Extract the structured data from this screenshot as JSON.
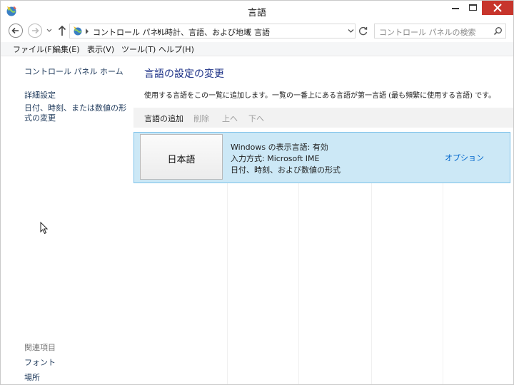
{
  "window": {
    "title": "言語",
    "accent_close": "#c7352c"
  },
  "address_bar": {
    "breadcrumbs": [
      "コントロール パネル",
      "時計、言語、および地域",
      "言語"
    ],
    "search_placeholder": "コントロール パネルの検索"
  },
  "menu": {
    "items": [
      "ファイル(F)",
      "編集(E)",
      "表示(V)",
      "ツール(T)",
      "ヘルプ(H)"
    ]
  },
  "left_pane": {
    "home_link": "コントロール パネル ホーム",
    "advanced_link": "詳細設定",
    "datetime_link": "日付、時刻、または数値の形式の変更",
    "related_header": "関連項目",
    "related": [
      "フォント",
      "場所"
    ]
  },
  "main": {
    "title": "言語の設定の変更",
    "description": "使用する言語をこの一覧に追加します。一覧の一番上にある言語が第一言語 (最も頻繁に使用する言語) です。",
    "toolbar": {
      "add": "言語の追加",
      "remove": "削除",
      "up": "上へ",
      "down": "下へ"
    },
    "languages": [
      {
        "name": "日本語",
        "info": [
          "Windows の表示言語: 有効",
          "入力方式: Microsoft IME",
          "日付、時刻、および数値の形式"
        ],
        "options": "オプション"
      }
    ]
  },
  "colors": {
    "selected_row": "#cce8f6",
    "selected_border": "#7dc2ea",
    "link": "#0066cc",
    "title": "#1e3287"
  }
}
